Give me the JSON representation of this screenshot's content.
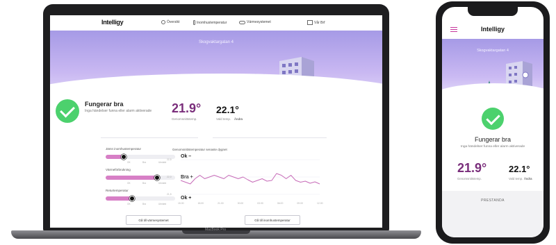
{
  "laptop": {
    "logo": "Intelligy",
    "brand_label": "MacBook Pro",
    "nav": [
      {
        "label": "Översikt",
        "icon": "dashboard-icon"
      },
      {
        "label": "Inomhustemperatur",
        "icon": "thermometer-icon"
      },
      {
        "label": "Värmesystemet",
        "icon": "heating-pipe-icon"
      },
      {
        "label": "Vår Brf",
        "icon": "building-icon"
      }
    ],
    "address": "Skogvaktargatan 4",
    "status": {
      "title": "Fungerar bra",
      "description": "Inga händelser funna eller alarm aktiverade",
      "color": "#4cd16d"
    },
    "average": {
      "value": "21.9°",
      "label": "Genomsnittstemp.",
      "color": "#7a2e7b"
    },
    "setpoint": {
      "value": "22.1°",
      "label": "Vald temp.",
      "change": "Ändra"
    },
    "metrics": [
      {
        "title": "Jämn inomhustemperatur",
        "rating": "Ok –",
        "level": 0.26,
        "scale": [
          "OK",
          "Bra",
          "Utmärkt"
        ]
      },
      {
        "title": "Värmeförbrukning",
        "rating": "Bra +",
        "level": 0.74,
        "scale": [
          "OK",
          "Bra",
          "Utmärkt"
        ]
      },
      {
        "title": "Returtemperatur",
        "rating": "Ok +",
        "level": 0.38,
        "scale": [
          "OK",
          "Bra",
          "Utmärkt"
        ]
      }
    ],
    "heating_button": "Gå till värmesystemet",
    "indoor_button": "Gå till inomhustemperatur",
    "accent": "#d77fc6"
  },
  "chart_data": {
    "type": "line",
    "title": "Genomsnittstemperatur senaste dygnet",
    "ylabel": "",
    "xlabel": "",
    "y_ticks": [
      "22,5",
      "22,0",
      "21,5"
    ],
    "ylim": [
      21.5,
      22.5
    ],
    "x_ticks": [
      "15.00",
      "18.00",
      "21.00",
      "00.00",
      "03.00",
      "06.00",
      "09.00",
      "12.00"
    ],
    "series": [
      {
        "values": [
          21.9,
          21.85,
          21.8,
          21.95,
          22.05,
          21.95,
          22.0,
          22.05,
          22.0,
          21.95,
          22.05,
          22.0,
          21.95,
          22.0,
          21.92,
          21.85,
          21.9,
          21.95,
          21.88,
          21.9,
          22.1,
          22.05,
          21.95,
          22.05,
          21.9,
          21.85,
          21.88,
          21.82,
          21.86,
          21.8
        ]
      }
    ]
  },
  "phone": {
    "logo": "Intelligy",
    "address": "Skogvaktargatan 4",
    "status_title": "Fungerar bra",
    "status_description": "Inga händelser funna eller alarm aktiverade",
    "average": {
      "value": "21.9°",
      "label": "Genomsnittstemp."
    },
    "setpoint": {
      "value": "22.1°",
      "label": "Vald temp.",
      "change": "Ändra"
    },
    "footer_label": "PRESTANDA",
    "menu_color": "#c7379c"
  }
}
